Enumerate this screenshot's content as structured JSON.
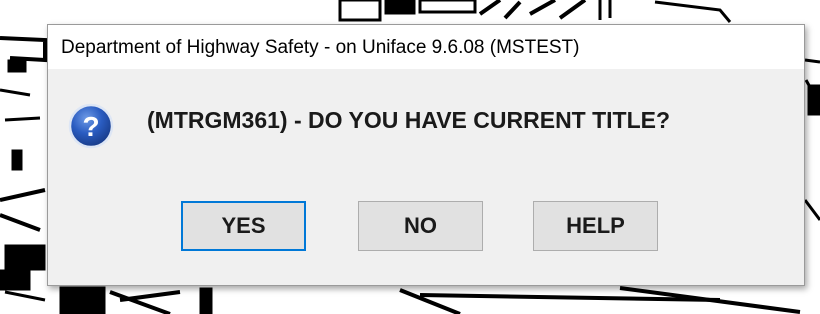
{
  "dialog": {
    "title": "Department of Highway Safety - on Uniface 9.6.08 (MSTEST)",
    "icon": "question-icon",
    "message": "(MTRGM361) - DO YOU HAVE CURRENT TITLE?",
    "buttons": {
      "yes_label": "YES",
      "no_label": "NO",
      "help_label": "HELP"
    },
    "default_button": "YES"
  },
  "colors": {
    "dialog_bg": "#f0f0f0",
    "titlebar_bg": "#ffffff",
    "focus_border": "#0078d7",
    "icon_blue": "#1f4fa8"
  }
}
